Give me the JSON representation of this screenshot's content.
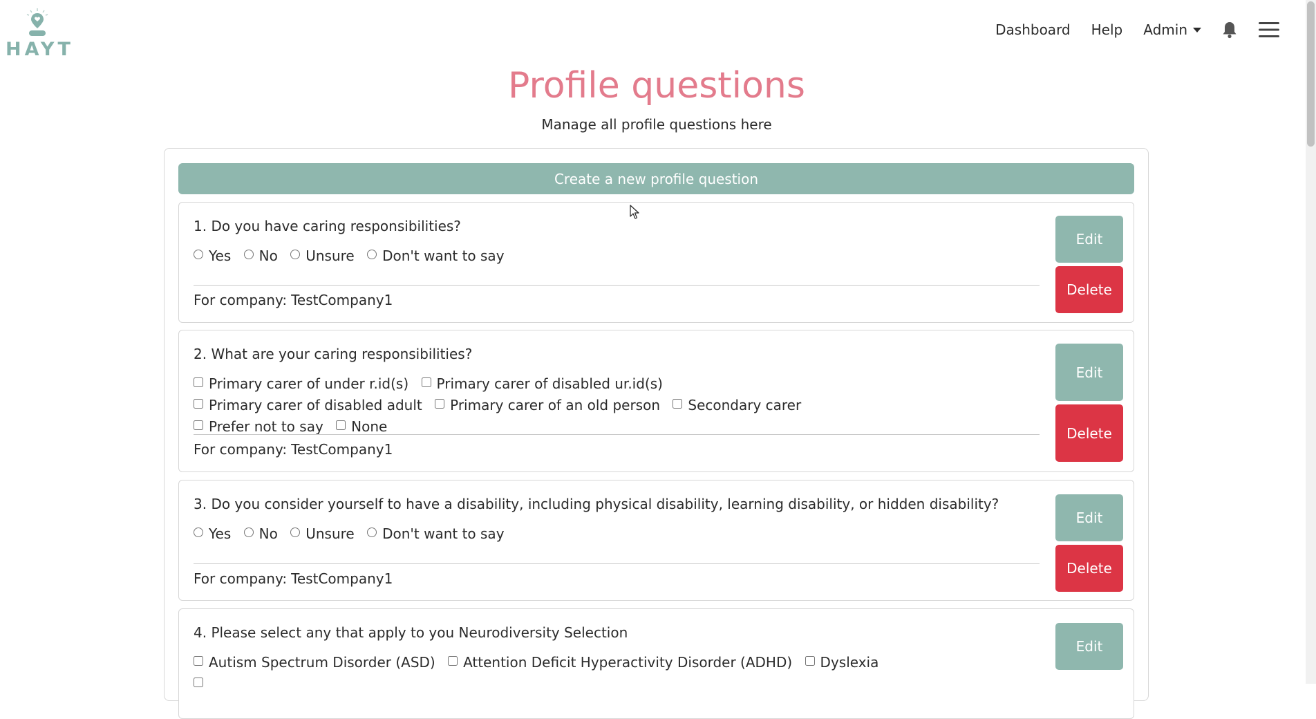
{
  "header": {
    "logo_text": "HAYT",
    "nav": {
      "dashboard": "Dashboard",
      "help": "Help",
      "admin": "Admin"
    }
  },
  "page": {
    "title": "Profile questions",
    "subtitle": "Manage all profile questions here",
    "create_button": "Create a new profile question"
  },
  "labels": {
    "company_prefix": "For company:",
    "edit": "Edit",
    "delete": "Delete"
  },
  "questions": [
    {
      "title": "1. Do you have caring responsibilities?",
      "input_type": "radio",
      "options": [
        "Yes",
        "No",
        "Unsure",
        "Don't want to say"
      ],
      "company": "TestCompany1"
    },
    {
      "title": "2. What are your caring responsibilities?",
      "input_type": "checkbox",
      "options": [
        "Primary carer of under r.id(s)",
        "Primary carer of disabled ur.id(s)",
        "Primary carer of disabled adult",
        "Primary carer of an old person",
        "Secondary carer",
        "Prefer not to say",
        "None"
      ],
      "company": "TestCompany1"
    },
    {
      "title": "3. Do you consider yourself to have a disability, including physical disability, learning disability, or hidden disability?",
      "input_type": "radio",
      "options": [
        "Yes",
        "No",
        "Unsure",
        "Don't want to say"
      ],
      "company": "TestCompany1"
    },
    {
      "title": "4. Please select any that apply to you Neurodiversity Selection",
      "input_type": "checkbox",
      "options": [
        "Autism Spectrum Disorder (ASD)",
        "Attention Deficit Hyperactivity Disorder (ADHD)",
        "Dyslexia"
      ],
      "company": ""
    }
  ],
  "colors": {
    "accent": "#8fb7ae",
    "title": "#e37b8c",
    "danger": "#dc3545"
  },
  "icons": {
    "logo": "person-pin-icon",
    "notifications": "bell-icon",
    "menu": "hamburger-icon"
  }
}
